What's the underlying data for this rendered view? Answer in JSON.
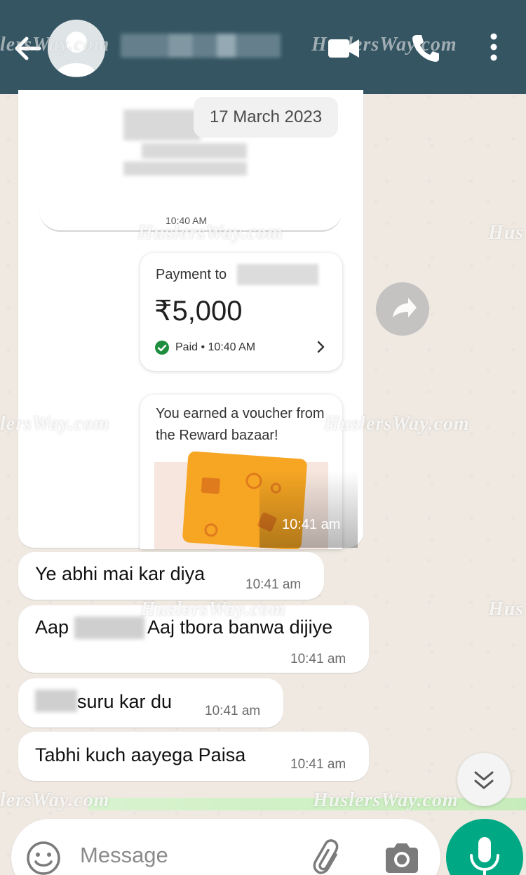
{
  "header": {
    "watermark_left": "lersWay.com",
    "watermark_right": "HuslersWay.com"
  },
  "chat": {
    "date_chip": "17 March 2023",
    "media_message": {
      "inner_time": "10:40 AM",
      "payment_label": "Payment to",
      "amount": "₹5,000",
      "status": "Paid • 10:40 AM",
      "voucher_text": "You earned a voucher from the Reward bazaar!",
      "time": "10:41 am"
    },
    "messages": [
      {
        "text": "Ye abhi mai kar diya",
        "time": "10:41 am"
      },
      {
        "text_before": "Aap",
        "text_after": "Aaj tbora banwa dijiye",
        "time": "10:41 am"
      },
      {
        "text": "suru kar du",
        "time": "10:41 am"
      },
      {
        "text": "Tabhi kuch aayega Paisa",
        "time": "10:41 am"
      }
    ],
    "watermarks": {
      "w1": "HuslersWay.com",
      "w2": "Hus",
      "w3": "lersWay.com",
      "w4": "HuslersWay.com",
      "w5": "HuslersWay.com",
      "w6": "Hus",
      "w7": "lersWay.com",
      "w8": "HuslersWay.com"
    }
  },
  "input": {
    "placeholder": "Message"
  },
  "colors": {
    "header": "#355563",
    "accent_green": "#00a884",
    "bubble": "#ffffff",
    "chat_bg": "#efe9e2"
  }
}
